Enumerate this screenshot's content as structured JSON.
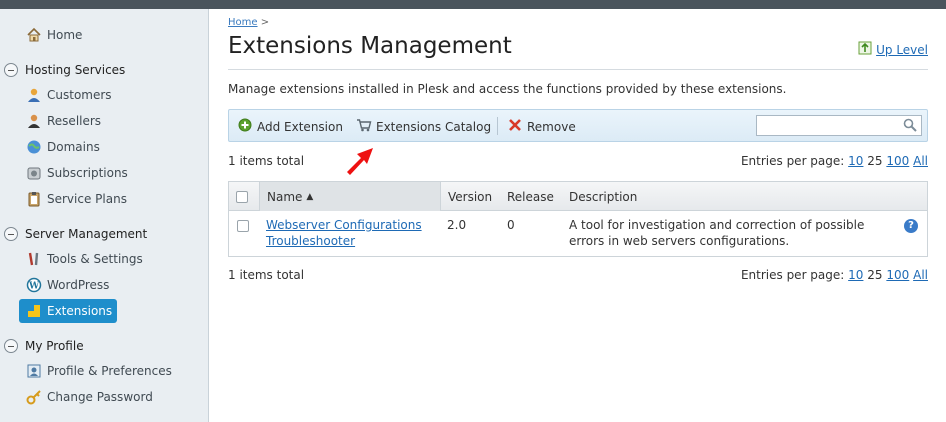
{
  "sidebar": {
    "home": "Home",
    "groups": [
      {
        "label": "Hosting Services",
        "items": [
          "Customers",
          "Resellers",
          "Domains",
          "Subscriptions",
          "Service Plans"
        ]
      },
      {
        "label": "Server Management",
        "items": [
          "Tools & Settings",
          "WordPress",
          "Extensions"
        ]
      },
      {
        "label": "My Profile",
        "items": [
          "Profile & Preferences",
          "Change Password"
        ]
      }
    ],
    "active_item": "Extensions"
  },
  "breadcrumb": {
    "home": "Home",
    "separator": ">"
  },
  "page": {
    "title": "Extensions Management",
    "up_level": "Up Level",
    "description": "Manage extensions installed in Plesk and access the functions provided by these extensions."
  },
  "toolbar": {
    "add_extension": "Add Extension",
    "extensions_catalog": "Extensions Catalog",
    "remove": "Remove",
    "search_value": ""
  },
  "list": {
    "total_top": "1 items total",
    "total_bottom": "1 items total",
    "entries_per_page_label": "Entries per page:",
    "page_sizes": [
      "10",
      "25",
      "100",
      "All"
    ],
    "current_page_size": "25",
    "columns": [
      "Name",
      "Version",
      "Release",
      "Description"
    ],
    "sort_indicator": "▲",
    "rows": [
      {
        "name_line1": "Webserver Configurations",
        "name_line2": "Troubleshooter",
        "version": "2.0",
        "release": "0",
        "description_line1": "A tool for investigation and correction of possible",
        "description_line2": "errors in web servers configurations."
      }
    ],
    "help_glyph": "?"
  },
  "colors": {
    "accent": "#1e8ecb",
    "link": "#1e6ab5",
    "arrow": "#ee1111"
  }
}
